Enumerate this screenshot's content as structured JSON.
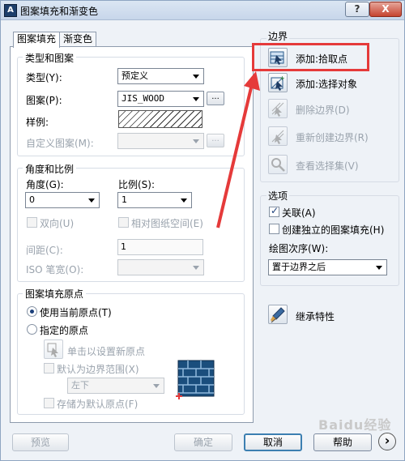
{
  "window": {
    "title": "图案填充和渐变色",
    "help_btn": "?",
    "close_btn": "X"
  },
  "tabs": [
    {
      "label": "图案填充"
    },
    {
      "label": "渐变色"
    }
  ],
  "type_pattern": {
    "group_title": "类型和图案",
    "type_label": "类型(Y):",
    "type_value": "预定义",
    "pattern_label": "图案(P):",
    "pattern_value": "JIS_WOOD",
    "pattern_browse": "...",
    "sample_label": "样例:",
    "custom_label": "自定义图案(M):",
    "custom_value": "",
    "custom_browse": "..."
  },
  "angle_scale": {
    "group_title": "角度和比例",
    "angle_label": "角度(G):",
    "angle_value": "0",
    "scale_label": "比例(S):",
    "scale_value": "1",
    "double_label": "双向(U)",
    "relative_label": "相对图纸空间(E)",
    "spacing_label": "间距(C):",
    "spacing_value": "1",
    "iso_label": "ISO 笔宽(O):",
    "iso_value": ""
  },
  "origin": {
    "group_title": "图案填充原点",
    "use_current_label": "使用当前原点(T)",
    "use_current_checked": true,
    "specified_label": "指定的原点",
    "click_set_label": "单击以设置新原点",
    "default_extent_label": "默认为边界范围(X)",
    "extent_value": "左下",
    "store_default_label": "存储为默认原点(F)"
  },
  "boundary": {
    "group_title": "边界",
    "add_pick_label": "添加:拾取点",
    "add_select_label": "添加:选择对象",
    "remove_label": "删除边界(D)",
    "recreate_label": "重新创建边界(R)",
    "view_label": "查看选择集(V)"
  },
  "options": {
    "group_title": "选项",
    "associative_label": "关联(A)",
    "associative_checked": true,
    "independent_label": "创建独立的图案填充(H)",
    "draw_order_label": "绘图次序(W):",
    "draw_order_value": "置于边界之后"
  },
  "inherit": {
    "label": "继承特性"
  },
  "footer": {
    "preview": "预览",
    "ok": "确定",
    "cancel": "取消",
    "help": "帮助",
    "more": "›"
  },
  "watermark": "Baidu经验",
  "colors": {
    "highlight": "#e53a3a",
    "accent": "#1b3f7a"
  }
}
